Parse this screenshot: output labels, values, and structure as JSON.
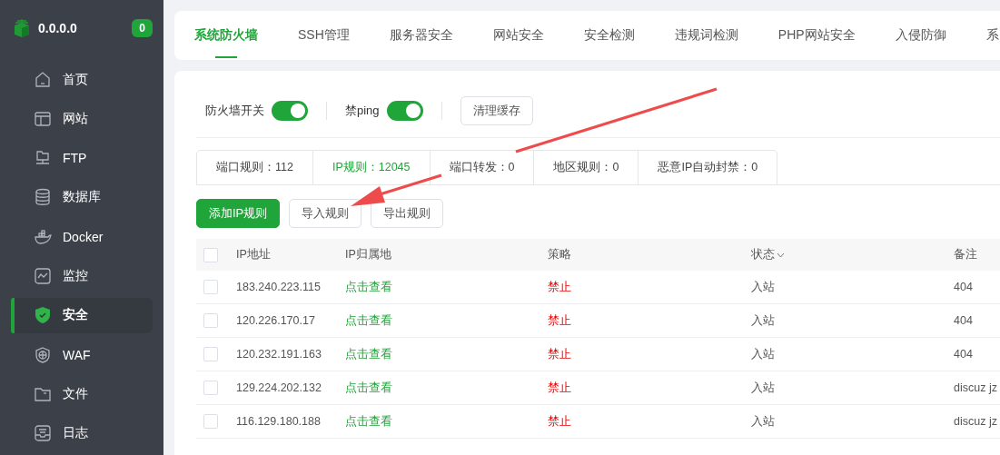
{
  "sidebar": {
    "host": "0.0.0.0",
    "badge": "0",
    "items": [
      {
        "label": "首页",
        "selected": false
      },
      {
        "label": "网站",
        "selected": false
      },
      {
        "label": "FTP",
        "selected": false
      },
      {
        "label": "数据库",
        "selected": false
      },
      {
        "label": "Docker",
        "selected": false
      },
      {
        "label": "监控",
        "selected": false
      },
      {
        "label": "安全",
        "selected": true
      },
      {
        "label": "WAF",
        "selected": false
      },
      {
        "label": "文件",
        "selected": false
      },
      {
        "label": "日志",
        "selected": false
      }
    ]
  },
  "tabs": [
    {
      "label": "系统防火墙",
      "selected": true
    },
    {
      "label": "SSH管理",
      "selected": false
    },
    {
      "label": "服务器安全",
      "selected": false
    },
    {
      "label": "网站安全",
      "selected": false
    },
    {
      "label": "安全检测",
      "selected": false
    },
    {
      "label": "违规词检测",
      "selected": false
    },
    {
      "label": "PHP网站安全",
      "selected": false
    },
    {
      "label": "入侵防御",
      "selected": false
    },
    {
      "label": "系",
      "selected": false
    }
  ],
  "toggles": [
    {
      "label": "防火墙开关",
      "on": true
    },
    {
      "label": "禁ping",
      "on": true
    }
  ],
  "clear_cache_button": "清理缓存",
  "rule_tabs": [
    {
      "label": "端口规则：112",
      "selected": false
    },
    {
      "label": "IP规则：12045",
      "selected": true
    },
    {
      "label": "端口转发：0",
      "selected": false
    },
    {
      "label": "地区规则：0",
      "selected": false
    },
    {
      "label": "恶意IP自动封禁：0",
      "selected": false
    }
  ],
  "actions": [
    {
      "label": "添加IP规则",
      "kind": "primary"
    },
    {
      "label": "导入规则",
      "kind": "default"
    },
    {
      "label": "导出规则",
      "kind": "default"
    }
  ],
  "table": {
    "select_all_checked": false,
    "columns": [
      {
        "label": "IP地址",
        "sortable": false
      },
      {
        "label": "IP归属地",
        "sortable": false
      },
      {
        "label": "策略",
        "sortable": false
      },
      {
        "label": "状态",
        "sortable": true
      },
      {
        "label": "备注",
        "sortable": false
      }
    ],
    "rows": [
      {
        "checked": false,
        "ip": "183.240.223.115",
        "location": "点击查看",
        "policy": "禁止",
        "status": "入站",
        "remark": "404"
      },
      {
        "checked": false,
        "ip": "120.226.170.17",
        "location": "点击查看",
        "policy": "禁止",
        "status": "入站",
        "remark": "404"
      },
      {
        "checked": false,
        "ip": "120.232.191.163",
        "location": "点击查看",
        "policy": "禁止",
        "status": "入站",
        "remark": "404"
      },
      {
        "checked": false,
        "ip": "129.224.202.132",
        "location": "点击查看",
        "policy": "禁止",
        "status": "入站",
        "remark": "discuz jz"
      },
      {
        "checked": false,
        "ip": "116.129.180.188",
        "location": "点击查看",
        "policy": "禁止",
        "status": "入站",
        "remark": "discuz jz"
      }
    ]
  }
}
